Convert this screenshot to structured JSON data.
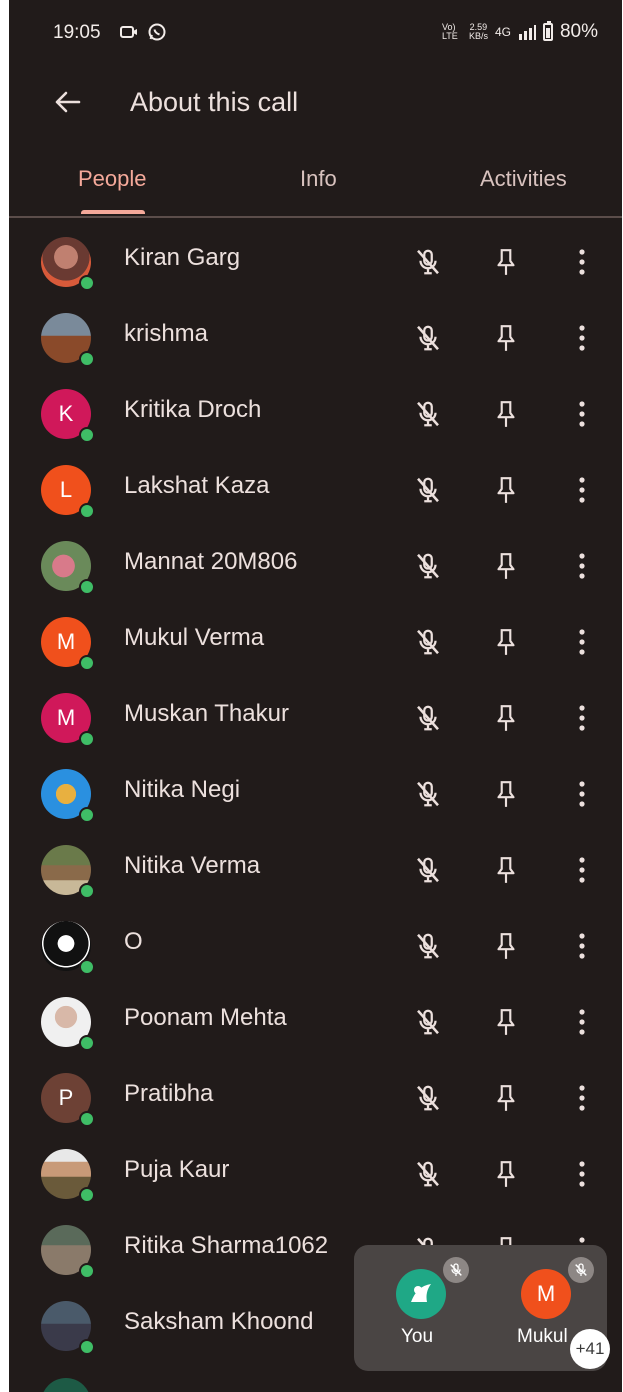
{
  "status_bar": {
    "time": "19:05",
    "lte": "Vo) LTE",
    "speed_value": "2.59",
    "speed_unit": "KB/s",
    "network": "4G",
    "battery": "80%"
  },
  "header": {
    "title": "About this call"
  },
  "tabs": [
    {
      "label": "People",
      "active": true
    },
    {
      "label": "Info",
      "active": false
    },
    {
      "label": "Activities",
      "active": false
    }
  ],
  "participants": [
    {
      "name": "Kiran Garg",
      "initial": "",
      "color": ""
    },
    {
      "name": "krishma",
      "initial": "",
      "color": ""
    },
    {
      "name": "Kritika Droch",
      "initial": "K",
      "color": "#d0185a"
    },
    {
      "name": "Lakshat Kaza",
      "initial": "L",
      "color": "#f0501c"
    },
    {
      "name": "Mannat 20M806",
      "initial": "",
      "color": ""
    },
    {
      "name": "Mukul Verma",
      "initial": "M",
      "color": "#f0501c"
    },
    {
      "name": "Muskan Thakur",
      "initial": "M",
      "color": "#d0185a"
    },
    {
      "name": "Nitika Negi",
      "initial": "",
      "color": ""
    },
    {
      "name": "Nitika Verma",
      "initial": "",
      "color": ""
    },
    {
      "name": "O",
      "initial": "",
      "color": ""
    },
    {
      "name": "Poonam Mehta",
      "initial": "",
      "color": ""
    },
    {
      "name": "Pratibha",
      "initial": "P",
      "color": "#6d4135"
    },
    {
      "name": "Puja Kaur",
      "initial": "",
      "color": ""
    },
    {
      "name": "Ritika Sharma1062",
      "initial": "",
      "color": ""
    },
    {
      "name": "Saksham Khoond",
      "initial": "",
      "color": ""
    }
  ],
  "floating_card": {
    "tile_you_label": "You",
    "tile_mukul_label": "Mukul",
    "tile_mukul_initial": "M",
    "more_count": "+41"
  },
  "colors": {
    "background": "#211b1a",
    "accent": "#f5a99a",
    "online_dot": "#3fbd66"
  }
}
